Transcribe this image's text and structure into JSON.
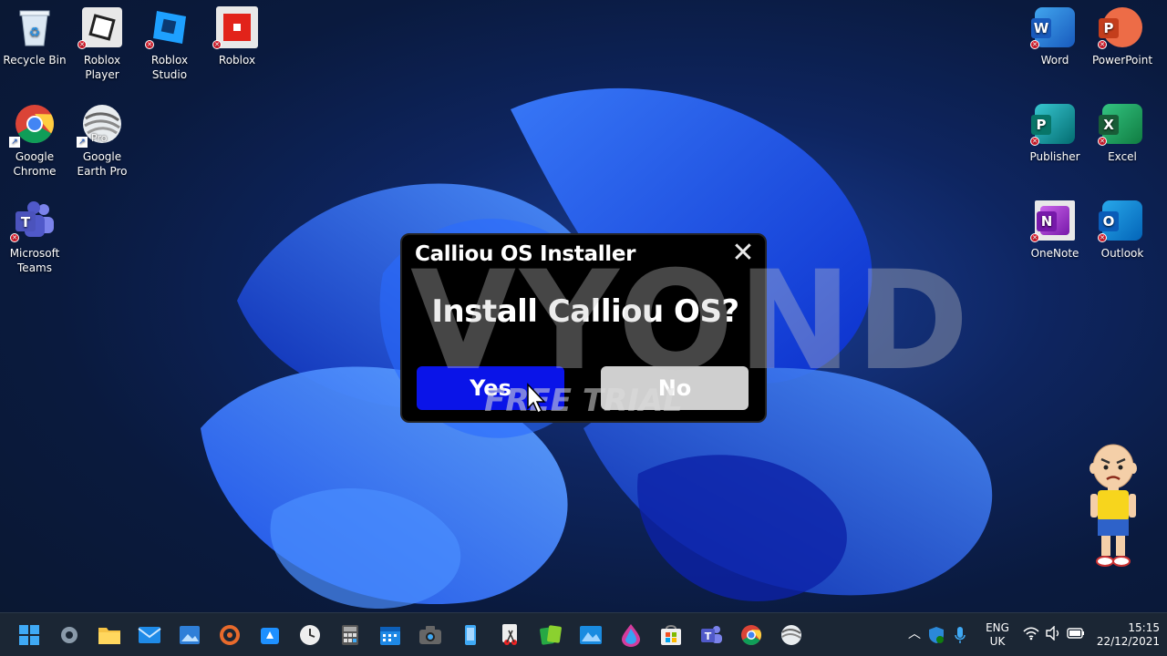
{
  "desktop": {
    "icons": [
      {
        "name": "Recycle Bin"
      },
      {
        "name": "Roblox Player"
      },
      {
        "name": "Roblox Studio"
      },
      {
        "name": "Roblox"
      },
      {
        "name": "Google Chrome"
      },
      {
        "name": "Google Earth Pro"
      },
      {
        "name": "Microsoft Teams"
      },
      {
        "name": "Word"
      },
      {
        "name": "PowerPoint"
      },
      {
        "name": "Publisher"
      },
      {
        "name": "Excel"
      },
      {
        "name": "OneNote"
      },
      {
        "name": "Outlook"
      }
    ],
    "google_earth_badge": "Pro"
  },
  "dialog": {
    "title": "Calliou OS Installer",
    "close_glyph": "✕",
    "question": "Install Calliou OS?",
    "yes_label": "Yes",
    "no_label": "No",
    "yes_color": "#0a14e8",
    "no_color": "#cfcfcf"
  },
  "watermark": {
    "logo": "VYOND",
    "trial": "FREE TRIAL"
  },
  "taskbar": {
    "icons": [
      "start-icon",
      "settings-icon",
      "file-explorer-icon",
      "mail-icon",
      "photos-icon",
      "media-player-icon",
      "store-icon",
      "clock-icon",
      "calculator-icon",
      "calendar-icon",
      "camera-icon",
      "phone-link-icon",
      "snipping-tool-icon",
      "solitaire-icon",
      "maps-icon",
      "paint-icon",
      "microsoft-store-icon",
      "teams-icon",
      "chrome-icon",
      "google-earth-icon"
    ],
    "tray": {
      "language_line1": "ENG",
      "language_line2": "UK",
      "time": "15:15",
      "date": "22/12/2021"
    }
  },
  "colors": {
    "word": "#2b5cc7",
    "powerpoint": "#d24726",
    "publisher": "#077568",
    "excel": "#1d7a45",
    "onenote": "#7b2fa6",
    "outlook": "#0f6cbd",
    "taskbar_bg": "#1b2634"
  }
}
